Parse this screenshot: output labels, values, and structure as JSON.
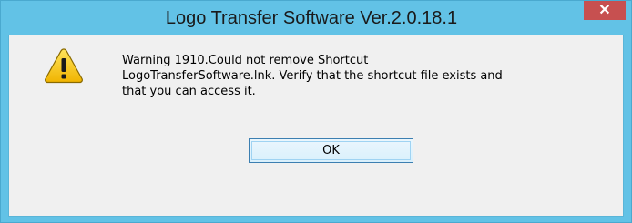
{
  "dialog": {
    "title": "Logo Transfer Software Ver.2.0.18.1",
    "close_glyph": "✕",
    "icon": "warning-icon",
    "message": "Warning 1910.Could not remove Shortcut\nLogoTransferSoftware.lnk. Verify that the shortcut file exists and\nthat you can access it.",
    "ok_label": "OK"
  },
  "colors": {
    "frame": "#62c2e6",
    "close_button": "#c75050",
    "client_background": "#f0f0f0",
    "warning_fill": "#f5c400"
  }
}
